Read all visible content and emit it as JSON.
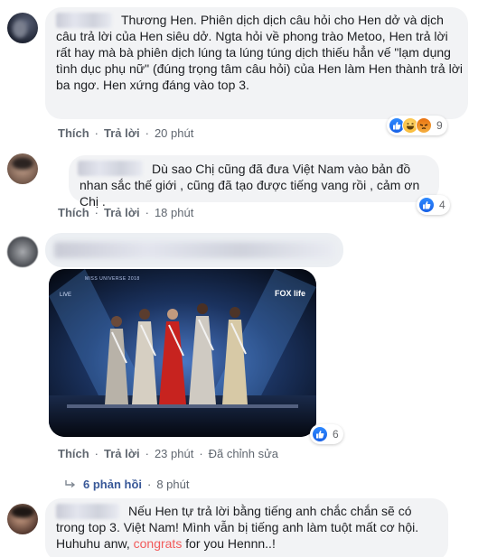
{
  "comments": [
    {
      "text": "Thương Hen. Phiên dịch dịch câu hỏi cho Hen dở và dịch câu trả lời của Hen siêu dở. Ngta hỏi về phong trào Metoo, Hen trả lời rất hay mà bà phiên dịch lúng ta lúng túng dịch thiếu hẳn vế \"lạm dụng tình dục phụ nữ\" (đúng trọng tâm câu hỏi) của Hen làm Hen thành trả lời ba ngơ. Hen xứng đáng vào top 3.",
      "like": "Thích",
      "reply": "Trả lời",
      "time": "20 phút",
      "reaction_count": "9",
      "reactions": [
        "like-icon",
        "haha-icon",
        "angry-icon"
      ]
    },
    {
      "text": "Dù sao Chị cũng đã đưa Việt Nam vào bản đồ nhan sắc thế giới , cũng đã tạo được tiếng vang rồi , cảm ơn Chị .",
      "like": "Thích",
      "reply": "Trả lời",
      "time": "18 phút",
      "reaction_count": "4",
      "reactions": [
        "like-icon"
      ]
    },
    {
      "image": {
        "broadcaster": "FOX life",
        "live": "LIVE",
        "overlay": "MISS UNIVERSE 2018"
      },
      "like": "Thích",
      "reply": "Trả lời",
      "time": "23 phút",
      "edited": "Đã chỉnh sửa",
      "reaction_count": "6",
      "reactions": [
        "like-icon"
      ]
    },
    {
      "text_before": "Nếu Hen tự trả lời bằng tiếng anh chắc chắn sẽ có trong top 3. Việt Nam! Mình vẫn bị tiếng anh làm tuột mất cơ hội. Huhuhu anw, ",
      "highlight": "congrats",
      "text_after": " for you Hennn..!"
    }
  ],
  "replies_link": {
    "label": "6 phản hồi",
    "time": "8 phút"
  },
  "colors": {
    "link": "#385898",
    "highlight": "#f25a5a",
    "bubble": "#f2f3f5",
    "like_blue": "#1877f2"
  }
}
